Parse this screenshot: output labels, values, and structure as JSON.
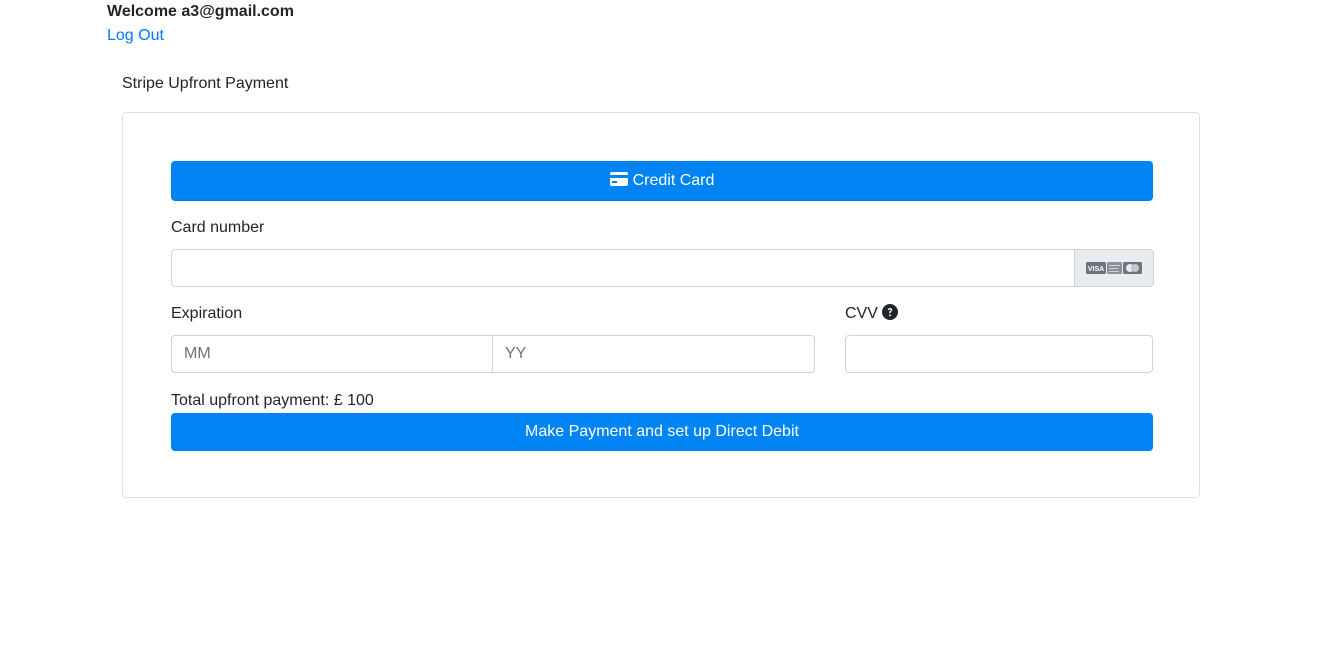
{
  "header": {
    "welcome_text": "Welcome a3@gmail.com",
    "logout_label": "Log Out"
  },
  "payment": {
    "section_title": "Stripe Upfront Payment",
    "credit_card_button_label": "Credit Card",
    "card_number_label": "Card number",
    "card_number_value": "",
    "accepted_cards": [
      "VISA",
      "Mastercard"
    ],
    "expiration_label": "Expiration",
    "month_placeholder": "MM",
    "year_placeholder": "YY",
    "cvv_label": "CVV",
    "cvv_value": "",
    "total_text": "Total upfront payment: £ 100",
    "submit_label": "Make Payment and set up Direct Debit"
  },
  "colors": {
    "primary": "#0084f4",
    "link": "#007bff",
    "text": "#212529",
    "addon_background": "#e9ecef",
    "border": "#ced4da"
  },
  "icons": {
    "credit_card": "credit-card-icon",
    "card_logos": "card-brand-logos-icon",
    "help": "question-circle-icon"
  }
}
